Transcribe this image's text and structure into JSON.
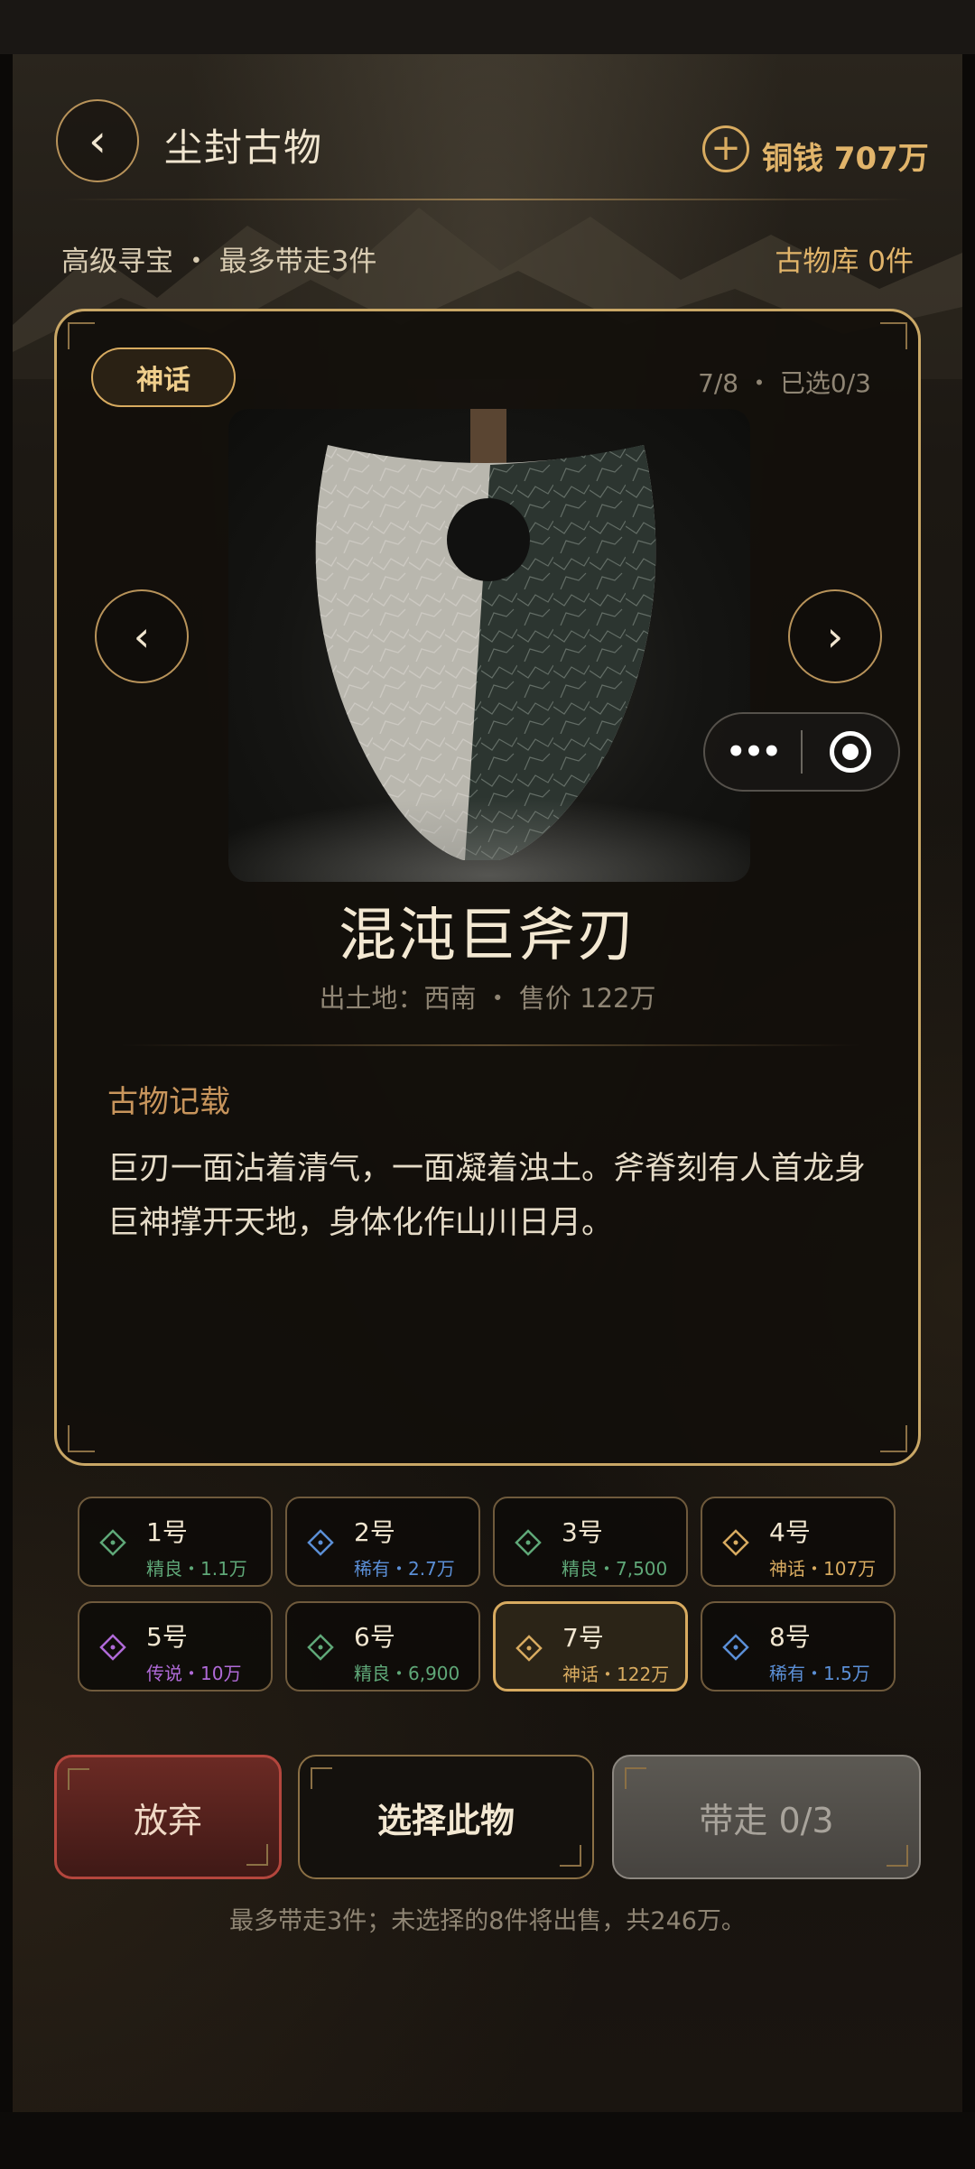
{
  "header": {
    "title": "尘封古物",
    "back_glyph": "‹",
    "add_glyph": "+",
    "coins": "铜钱 707万"
  },
  "subheader": {
    "mode": "高级寻宝 ・ 最多带走3件",
    "storage": "古物库 0件"
  },
  "card": {
    "rarity": "神话",
    "counter": "7/8 ・ 已选0/3",
    "prev_glyph": "‹",
    "next_glyph": "›",
    "item_name": "混沌巨斧刃",
    "item_meta": "出土地：西南 ・ 售价 122万",
    "record_title": "古物记载",
    "record_text": "巨刃一面沾着清气，一面凝着浊土。斧脊刻有人首龙身巨神撑开天地，身体化作山川日月。",
    "capsule_more": "•••"
  },
  "slots": [
    {
      "num": "1号",
      "sub": "精良・1.1万",
      "color": "#5fa878"
    },
    {
      "num": "2号",
      "sub": "稀有・2.7万",
      "color": "#5b8fd6"
    },
    {
      "num": "3号",
      "sub": "精良・7,500",
      "color": "#5fa878"
    },
    {
      "num": "4号",
      "sub": "神话・107万",
      "color": "#d8ab60"
    },
    {
      "num": "5号",
      "sub": "传说・10万",
      "color": "#b06ad8"
    },
    {
      "num": "6号",
      "sub": "精良・6,900",
      "color": "#5fa878"
    },
    {
      "num": "7号",
      "sub": "神话・122万",
      "color": "#d8ab60"
    },
    {
      "num": "8号",
      "sub": "稀有・1.5万",
      "color": "#5b8fd6"
    }
  ],
  "actions": {
    "abandon": "放弃",
    "select": "选择此物",
    "take": "带走 0/3"
  },
  "footnote": "最多带走3件；未选择的8件将出售，共246万。",
  "colors": {
    "gold": "#d8ab60",
    "rare_blue": "#5b8fd6",
    "fine_green": "#5fa878",
    "legend_purple": "#b06ad8"
  }
}
